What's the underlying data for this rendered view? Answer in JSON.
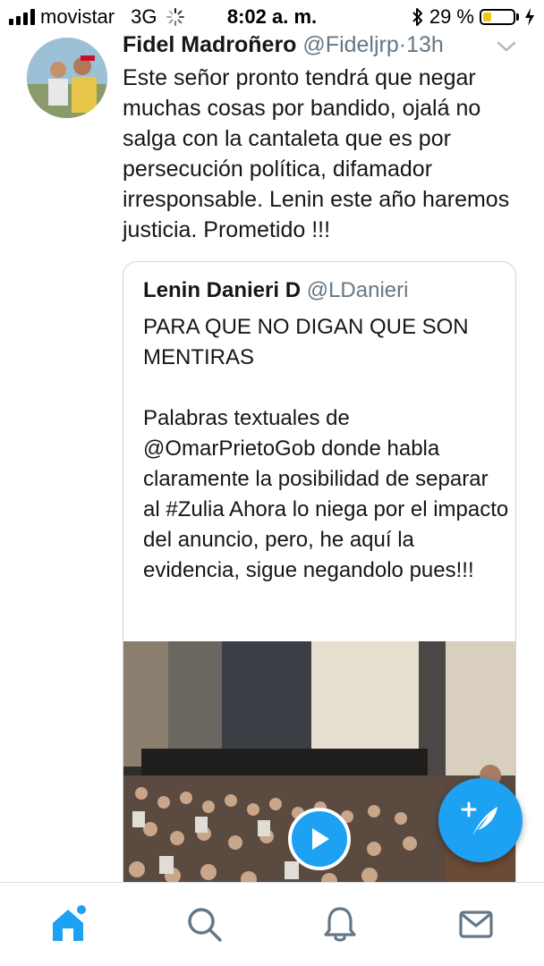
{
  "status_bar": {
    "carrier": "movistar",
    "network": "3G",
    "time": "8:02 a. m.",
    "battery_percent": "29 %",
    "battery_level": 0.29,
    "icons": [
      "signal-bars-icon",
      "activity-spinner-icon",
      "bluetooth-icon",
      "battery-icon",
      "charging-bolt-icon"
    ]
  },
  "tweet": {
    "author_name": "Fidel Madroñero",
    "author_handle": "@Fideljrp",
    "separator": "·",
    "time": "13h",
    "text": "Este señor pronto tendrá que negar muchas cosas por bandido, ojalá no salga con la cantaleta que es por persecución política, difamador irresponsable. Lenin este año haremos justicia. Prometido !!!"
  },
  "quoted_tweet": {
    "author_name": "Lenin Danieri D",
    "author_handle": "@LDanieri",
    "paragraph_1": "PARA QUE NO DIGAN QUE SON MENTIRAS",
    "paragraph_2": "Palabras textuales de @OmarPrietoGob donde habla claramente la posibilidad de separar al #Zulia Ahora lo niega por el impacto del anuncio, pero, he aquí la evidencia, sigue negandolo pues!!!",
    "media_icon": "play-icon"
  },
  "fab": {
    "icon": "compose-tweet-icon"
  },
  "tab_bar": {
    "tabs": [
      {
        "icon": "home-icon",
        "active": true
      },
      {
        "icon": "search-icon",
        "active": false
      },
      {
        "icon": "notifications-bell-icon",
        "active": false
      },
      {
        "icon": "messages-envelope-icon",
        "active": false
      }
    ]
  },
  "colors": {
    "accent": "#1da1f2",
    "text_primary": "#14171a",
    "text_secondary": "#657786",
    "border": "#ccd6dd",
    "battery_low": "#f5c518"
  }
}
